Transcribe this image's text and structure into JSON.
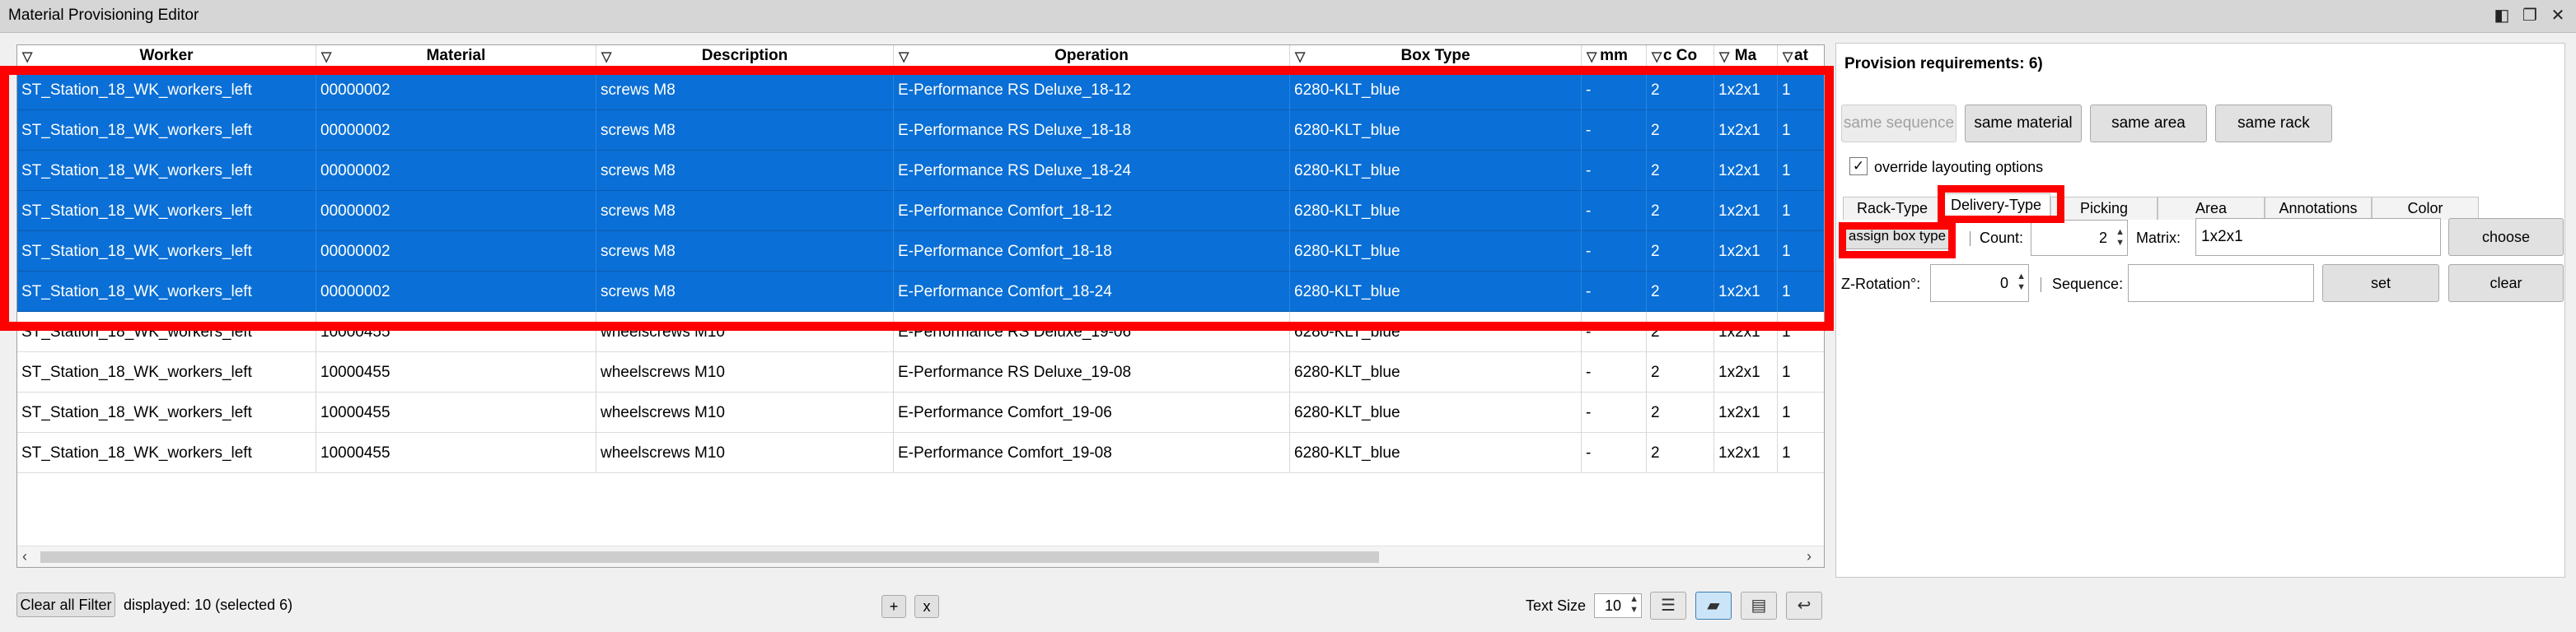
{
  "window": {
    "title": "Material Provisioning Editor",
    "buttons": [
      "◧",
      "❐",
      "✕"
    ]
  },
  "table": {
    "columns": [
      {
        "label": "Worker"
      },
      {
        "label": "Material"
      },
      {
        "label": "Description"
      },
      {
        "label": "Operation"
      },
      {
        "label": "Box Type"
      },
      {
        "label": "mm"
      },
      {
        "label": "c Co"
      },
      {
        "label": "Ma"
      },
      {
        "label": "at"
      }
    ],
    "rows": [
      {
        "selected": true,
        "cells": [
          "ST_Station_18_WK_workers_left",
          "00000002",
          "screws M8",
          "E-Performance RS Deluxe_18-12",
          "6280-KLT_blue",
          "-",
          "2",
          "1x2x1",
          "1"
        ]
      },
      {
        "selected": true,
        "cells": [
          "ST_Station_18_WK_workers_left",
          "00000002",
          "screws M8",
          "E-Performance RS Deluxe_18-18",
          "6280-KLT_blue",
          "-",
          "2",
          "1x2x1",
          "1"
        ]
      },
      {
        "selected": true,
        "cells": [
          "ST_Station_18_WK_workers_left",
          "00000002",
          "screws M8",
          "E-Performance RS Deluxe_18-24",
          "6280-KLT_blue",
          "-",
          "2",
          "1x2x1",
          "1"
        ]
      },
      {
        "selected": true,
        "cells": [
          "ST_Station_18_WK_workers_left",
          "00000002",
          "screws M8",
          "E-Performance Comfort_18-12",
          "6280-KLT_blue",
          "-",
          "2",
          "1x2x1",
          "1"
        ]
      },
      {
        "selected": true,
        "cells": [
          "ST_Station_18_WK_workers_left",
          "00000002",
          "screws M8",
          "E-Performance Comfort_18-18",
          "6280-KLT_blue",
          "-",
          "2",
          "1x2x1",
          "1"
        ]
      },
      {
        "selected": true,
        "cells": [
          "ST_Station_18_WK_workers_left",
          "00000002",
          "screws M8",
          "E-Performance Comfort_18-24",
          "6280-KLT_blue",
          "-",
          "2",
          "1x2x1",
          "1"
        ]
      },
      {
        "selected": false,
        "cells": [
          "ST_Station_18_WK_workers_left",
          "10000455",
          "wheelscrews M10",
          "E-Performance RS Deluxe_19-06",
          "6280-KLT_blue",
          "-",
          "2",
          "1x2x1",
          "1"
        ]
      },
      {
        "selected": false,
        "cells": [
          "ST_Station_18_WK_workers_left",
          "10000455",
          "wheelscrews M10",
          "E-Performance RS Deluxe_19-08",
          "6280-KLT_blue",
          "-",
          "2",
          "1x2x1",
          "1"
        ]
      },
      {
        "selected": false,
        "cells": [
          "ST_Station_18_WK_workers_left",
          "10000455",
          "wheelscrews M10",
          "E-Performance Comfort_19-06",
          "6280-KLT_blue",
          "-",
          "2",
          "1x2x1",
          "1"
        ]
      },
      {
        "selected": false,
        "cells": [
          "ST_Station_18_WK_workers_left",
          "10000455",
          "wheelscrews M10",
          "E-Performance Comfort_19-08",
          "6280-KLT_blue",
          "-",
          "2",
          "1x2x1",
          "1"
        ]
      }
    ]
  },
  "footer": {
    "clear_filter": "Clear all Filter",
    "displayed": "displayed: 10 (selected 6)",
    "plus": "+",
    "x": "x",
    "text_size_label": "Text Size",
    "text_size_value": "10"
  },
  "panel": {
    "title": "Provision requirements: 6)",
    "same_sequence": "same sequence",
    "same_material": "same material",
    "same_area": "same area",
    "same_rack": "same rack",
    "override_label": "override layouting options",
    "override_checked": "✓",
    "tabs": [
      "Rack-Type",
      "Delivery-Type",
      "Picking",
      "Area",
      "Annotations",
      "Color"
    ],
    "assign_box_type": "assign box type",
    "count_label": "Count:",
    "count_value": "2",
    "matrix_label": "Matrix:",
    "matrix_value": "1x2x1",
    "choose": "choose",
    "zrot_label": "Z-Rotation°:",
    "zrot_value": "0",
    "sequence_label": "Sequence:",
    "sequence_value": "",
    "set": "set",
    "clear": "clear"
  },
  "colors": {
    "selection": "#0a6fd6",
    "highlight": "#ff0000"
  }
}
